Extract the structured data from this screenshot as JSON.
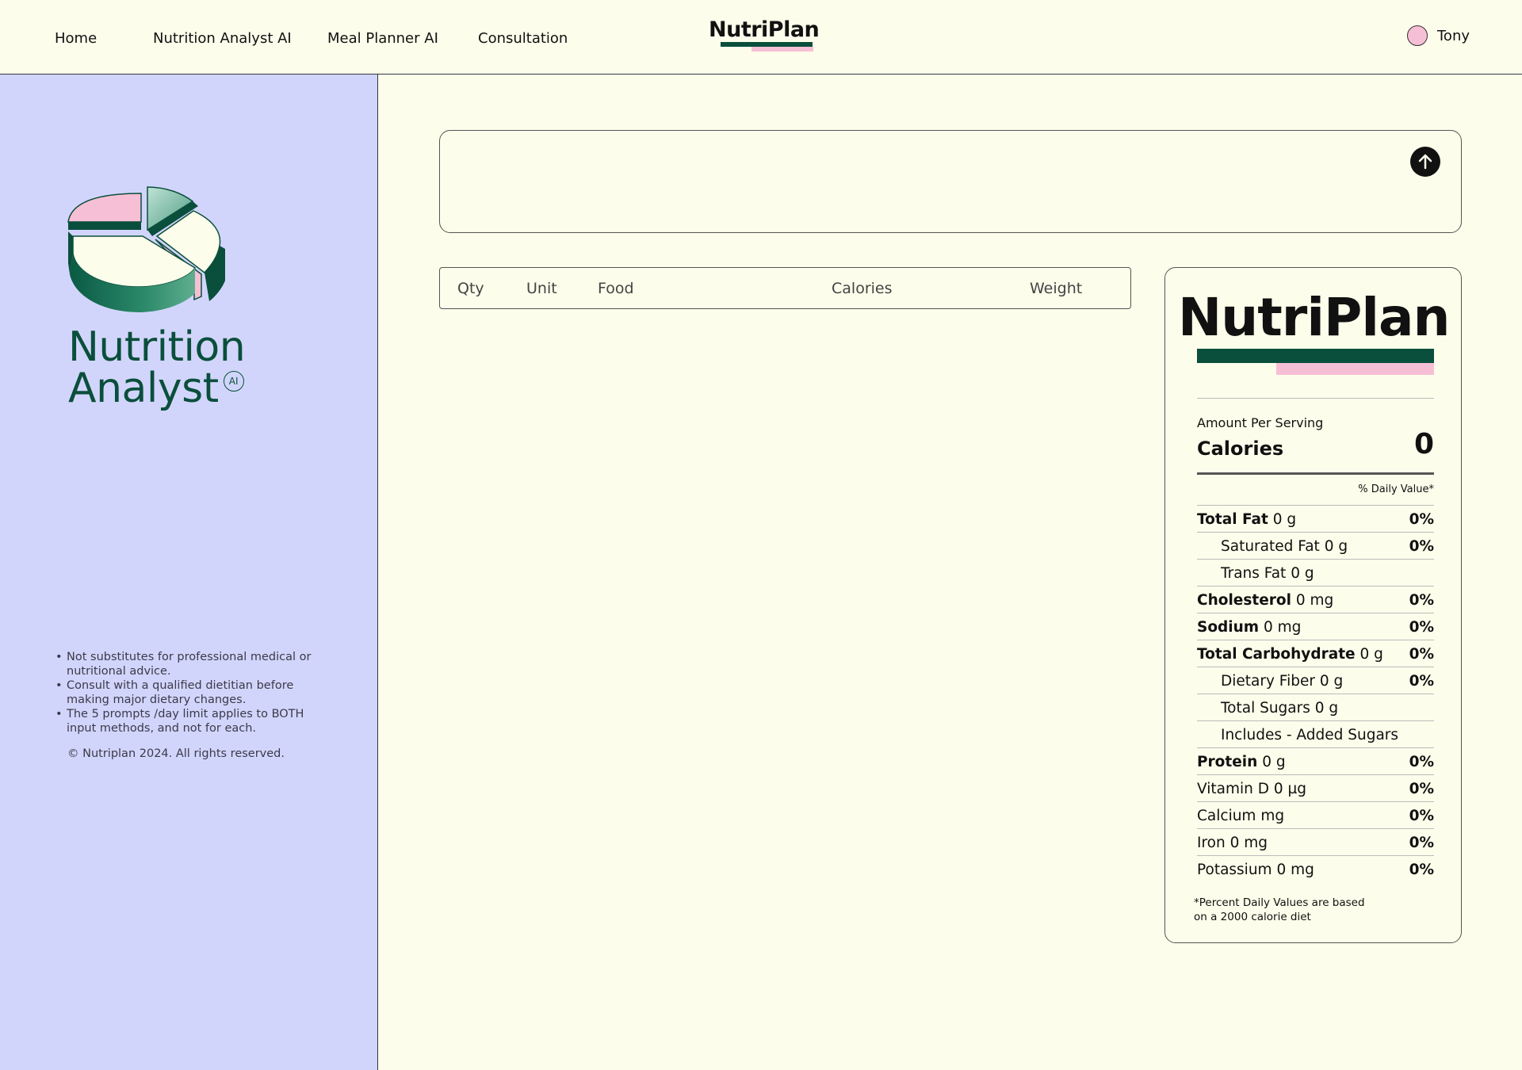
{
  "header": {
    "nav": [
      "Home",
      "Nutrition Analyst AI",
      "Meal Planner AI",
      "Consultation"
    ],
    "logo": "NutriPlan",
    "user_name": "Tony"
  },
  "sidebar": {
    "title_line1": "Nutrition",
    "title_line2": "Analyst",
    "ai_badge": "AI",
    "notes": [
      "Not substitutes for professional medical or nutritional advice.",
      "Consult with a qualified dietitian before making major dietary changes.",
      "The 5 prompts /day limit applies to BOTH input methods, and not for each."
    ],
    "copyright": "© Nutriplan 2024. All rights reserved."
  },
  "prompt": {
    "value": "",
    "placeholder": "",
    "send_icon": "arrow-up-icon"
  },
  "food_table": {
    "columns": [
      "Qty",
      "Unit",
      "Food",
      "Calories",
      "Weight"
    ],
    "rows": []
  },
  "nutrition_label": {
    "logo": "NutriPlan",
    "amount_per_serving": "Amount Per Serving",
    "calories_label": "Calories",
    "calories_value": "0",
    "daily_value_header": "% Daily Value*",
    "rows": [
      {
        "name": "Total Fat",
        "amount": "0 g",
        "percent": "0%"
      },
      {
        "name": "Saturated Fat",
        "amount": "0 g",
        "percent": "0%"
      },
      {
        "name": "Trans Fat",
        "amount": "0 g",
        "percent": ""
      },
      {
        "name": "Cholesterol",
        "amount": "0 mg",
        "percent": "0%"
      },
      {
        "name": "Sodium",
        "amount": "0 mg",
        "percent": "0%"
      },
      {
        "name": "Total Carbohydrate",
        "amount": "0 g",
        "percent": "0%"
      },
      {
        "name": "Dietary Fiber",
        "amount": "0 g",
        "percent": "0%"
      },
      {
        "name": "Total Sugars",
        "amount": "0 g",
        "percent": ""
      },
      {
        "name": "Includes - Added Sugars",
        "amount": "",
        "percent": ""
      },
      {
        "name": "Protein",
        "amount": "0 g",
        "percent": "0%"
      },
      {
        "name": "Vitamin D",
        "amount": "0 µg",
        "percent": "0%"
      },
      {
        "name": "Calcium",
        "amount": " mg",
        "percent": "0%"
      },
      {
        "name": "Iron",
        "amount": "0 mg",
        "percent": "0%"
      },
      {
        "name": "Potassium",
        "amount": "0 mg",
        "percent": "0%"
      }
    ],
    "footnote_line1": "*Percent Daily Values are based",
    "footnote_line2": "on a 2000 calorie diet"
  },
  "colors": {
    "background": "#fdfdeb",
    "sidebar": "#d2d5fb",
    "brand_green": "#0a4f3c",
    "brand_pink": "#f7bfd5"
  }
}
